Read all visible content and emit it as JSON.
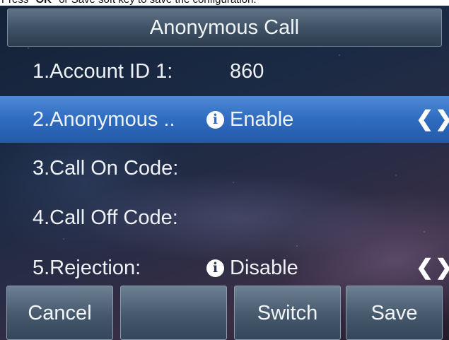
{
  "caption": {
    "text_before": "Press",
    "ok_glyph": "OK",
    "text_after": "or Save soft key to save the configuration."
  },
  "header": {
    "title": "Anonymous Call"
  },
  "rows": [
    {
      "label": "1.Account ID 1:",
      "value": "860",
      "selected": false,
      "has_info": false,
      "has_arrows": false
    },
    {
      "label": "2.Anonymous ..",
      "value": "Enable",
      "selected": true,
      "has_info": true,
      "has_arrows": true
    },
    {
      "label": "3.Call On Code:",
      "value": "",
      "selected": false,
      "has_info": false,
      "has_arrows": false
    },
    {
      "label": "4.Call Off Code:",
      "value": "",
      "selected": false,
      "has_info": false,
      "has_arrows": false
    },
    {
      "label": "5.Rejection:",
      "value": "Disable",
      "selected": false,
      "has_info": true,
      "has_arrows": true
    }
  ],
  "icons": {
    "info": "i",
    "arrows": "❮❯"
  },
  "softkeys": [
    "Cancel",
    "",
    "Switch",
    "Save"
  ],
  "colors": {
    "selection": "#2f6cc0",
    "softkey": "#46596c",
    "title_bar": "#3d5063"
  }
}
